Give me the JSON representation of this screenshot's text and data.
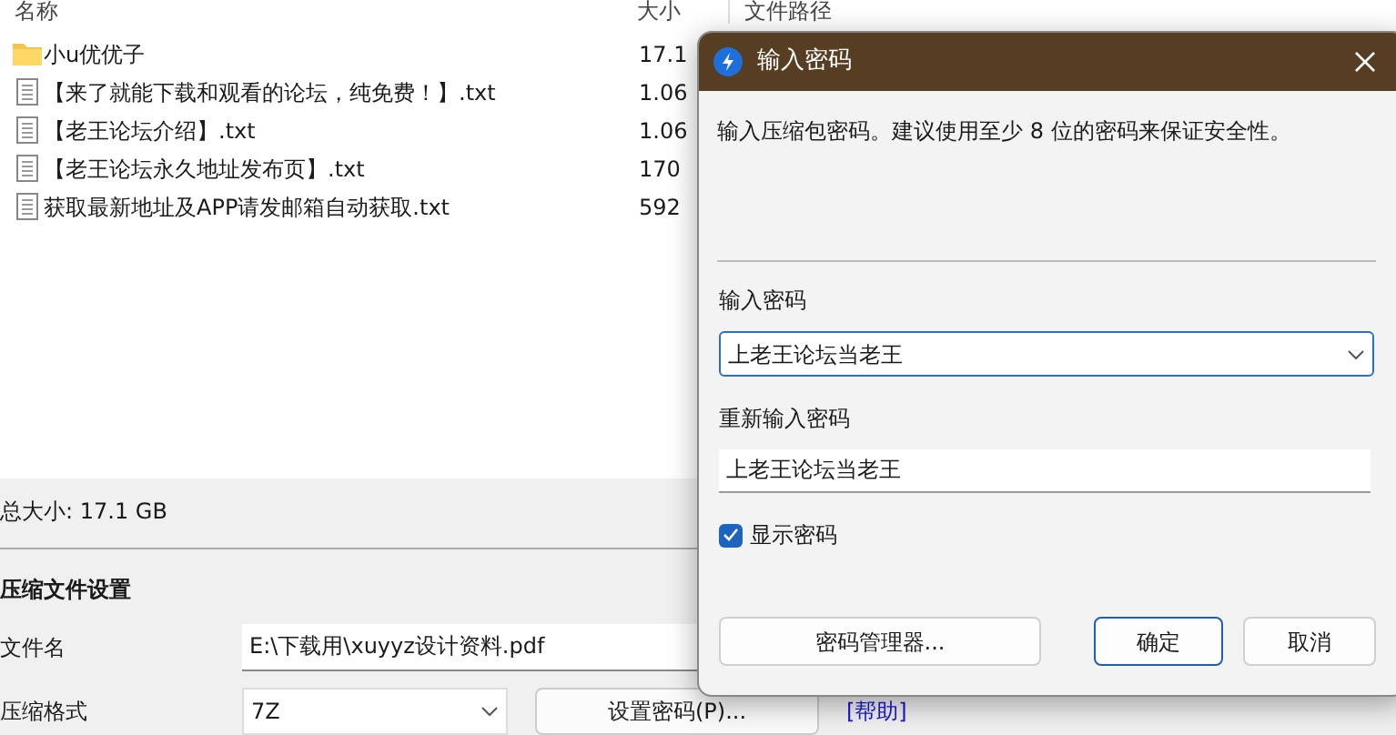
{
  "file_list": {
    "columns": [
      "名称",
      "大小",
      "文件路径"
    ],
    "rows": [
      {
        "kind": "folder",
        "name": "小u优优子",
        "size": "17.1"
      },
      {
        "kind": "text",
        "name": "【来了就能下载和观看的论坛，纯免费！】.txt",
        "size": "1.06"
      },
      {
        "kind": "text",
        "name": "【老王论坛介绍】.txt",
        "size": "1.06"
      },
      {
        "kind": "text",
        "name": "【老王论坛永久地址发布页】.txt",
        "size": "170"
      },
      {
        "kind": "text",
        "name": "获取最新地址及APP请发邮箱自动获取.txt",
        "size": "592"
      }
    ]
  },
  "total_size": "总大小: 17.1 GB",
  "settings": {
    "title": "压缩文件设置",
    "filename_label": "文件名",
    "filename_value": "E:\\下载用\\xuyyz设计资料.pdf",
    "format_label": "压缩格式",
    "format_value": "7Z",
    "set_password_button": "设置密码(P)...",
    "help_link": "[帮助]"
  },
  "dialog": {
    "title": "输入密码",
    "message": "输入压缩包密码。建议使用至少 8 位的密码来保证安全性。",
    "password_label": "输入密码",
    "password_value": "上老王论坛当老王",
    "repeat_label": "重新输入密码",
    "repeat_value": "上老王论坛当老王",
    "show_password": {
      "label": "显示密码",
      "checked": true
    },
    "buttons": [
      {
        "label": "密码管理器...",
        "primary": false
      },
      {
        "label": "确定",
        "primary": true
      },
      {
        "label": "取消",
        "primary": false
      }
    ]
  }
}
